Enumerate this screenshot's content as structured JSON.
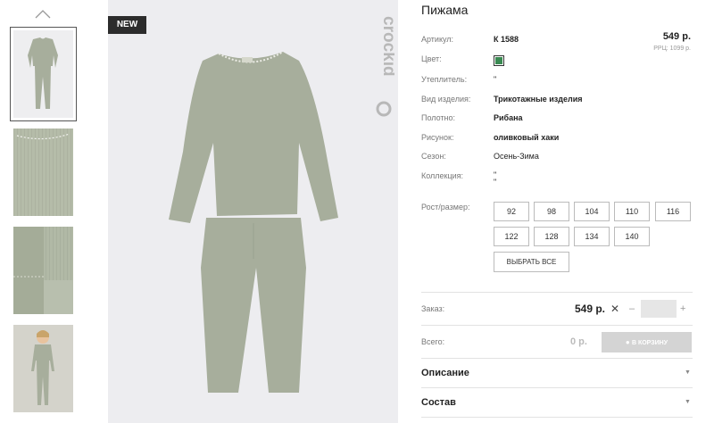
{
  "thumbnails": {
    "up_icon": "chevron-up-icon",
    "items": [
      "full-product",
      "collar-closeup",
      "cuff-closeup",
      "kid-model"
    ]
  },
  "main_image": {
    "badge": "NEW",
    "brand": "crockid",
    "garment_color": "#a7ae9c"
  },
  "product": {
    "title": "Пижама",
    "price": "549 р.",
    "rrp": "РРЦ: 1099 р.",
    "attributes": [
      {
        "label": "Артикул:",
        "value": "К 1588"
      },
      {
        "label": "Цвет:",
        "value": ""
      },
      {
        "label": "Утеплитель:",
        "value": "\""
      },
      {
        "label": "Вид изделия:",
        "value": "Трикотажные изделия"
      },
      {
        "label": "Полотно:",
        "value": "Рибана"
      },
      {
        "label": "Рисунок:",
        "value": "оливковый хаки"
      },
      {
        "label": "Сезон:",
        "value": "Осень-Зима"
      },
      {
        "label": "Коллекция:",
        "value": "\"\n\""
      }
    ],
    "swatch_color": "#3a8a52",
    "size_label": "Рост/размер:",
    "sizes": [
      "92",
      "98",
      "104",
      "110",
      "116",
      "122",
      "128",
      "134",
      "140"
    ],
    "select_all": "ВЫБРАТЬ ВСЕ"
  },
  "order": {
    "label": "Заказ:",
    "price": "549 р.",
    "times": "✕",
    "minus": "–",
    "plus": "+",
    "qty": "",
    "total_label": "Всего:",
    "total": "0 р.",
    "cart_button": "В КОРЗИНУ"
  },
  "accordion": [
    {
      "title": "Описание",
      "caret": "▼"
    },
    {
      "title": "Состав",
      "caret": "▼"
    }
  ]
}
